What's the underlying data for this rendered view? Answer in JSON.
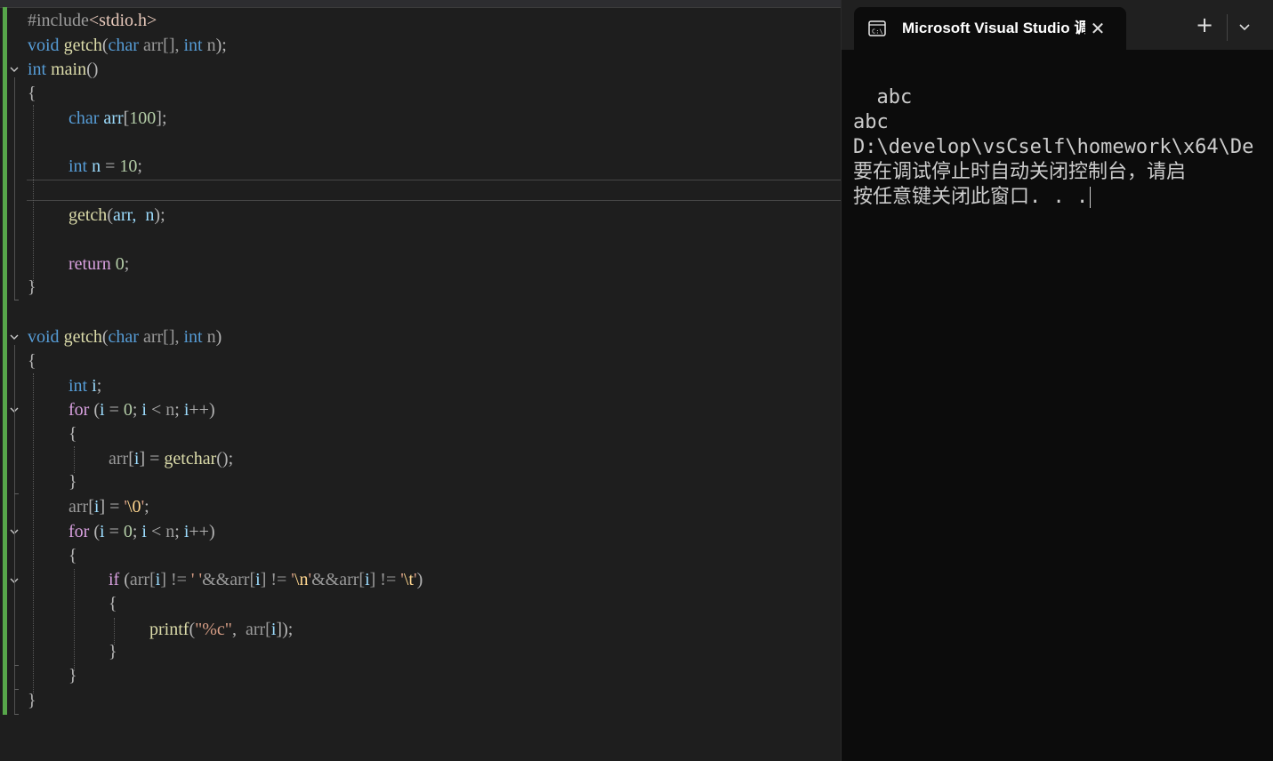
{
  "editor": {
    "lines": {
      "l1": {
        "directive": "#include",
        "header": "<stdio.h>"
      },
      "l2": {
        "kw_void": "void",
        "fn": "getch",
        "p_open": "(",
        "kw_char": "char",
        "param1": " arr[], ",
        "kw_int": "int",
        "param2": " n",
        "p_close": ")",
        "semi": ";"
      },
      "l3": {
        "kw_int": "int",
        "fn": "main",
        "parens": "()"
      },
      "l4": {
        "brace": "{"
      },
      "l5": {
        "kw_char": "char",
        "var": " arr",
        "br_open": "[",
        "num": "100",
        "br_close": "]",
        "semi": ";"
      },
      "l6": {
        "kw_int": "int",
        "var": " n",
        "op": " = ",
        "num": "10",
        "semi": ";"
      },
      "l7": {
        "fn": "getch",
        "p_open": "(",
        "args": "arr,  n",
        "p_close": ")",
        "semi": ";"
      },
      "l8": {
        "kw": "return",
        "num": " 0",
        "semi": ";"
      },
      "l9": {
        "brace": "}"
      },
      "l10": {
        "kw_void": "void",
        "fn": "getch",
        "p_open": "(",
        "kw_char": "char",
        "param1": " arr[], ",
        "kw_int": "int",
        "param2": " n",
        "p_close": ")"
      },
      "l11": {
        "brace": "{"
      },
      "l12": {
        "kw_int": "int",
        "var": " i",
        "semi": ";"
      },
      "l13": {
        "kw": "for",
        "p_open": " (",
        "a": "i",
        "b": " = ",
        "num": "0",
        "c": "; ",
        "d": "i",
        "e": " < ",
        "f": "n",
        "g": "; ",
        "h": "i",
        "i2": "++",
        "p_close": ")"
      },
      "l14": {
        "brace": "{"
      },
      "l15": {
        "arr": "arr",
        "bo": "[",
        "idx": "i",
        "bc": "]",
        "op": " = ",
        "fn": "getchar",
        "call": "()",
        "semi": ";"
      },
      "l16": {
        "brace": "}"
      },
      "l17": {
        "arr": "arr",
        "bo": "[",
        "idx": "i",
        "bc": "]",
        "op": " = ",
        "str_q1": "'",
        "esc": "\\0",
        "str_q2": "'",
        "semi": ";"
      },
      "l18": {
        "kw": "for",
        "p_open": " (",
        "a": "i",
        "b": " = ",
        "num": "0",
        "c": "; ",
        "d": "i",
        "e": " < ",
        "f": "n",
        "g": "; ",
        "h": "i",
        "i2": "++",
        "p_close": ")"
      },
      "l19": {
        "brace": "{"
      },
      "l20": {
        "kw": "if",
        "p_open": " (",
        "a": "arr[",
        "i1": "i",
        "b": "] != ",
        "s1": "' '",
        "c": "&&arr[",
        "i2": "i",
        "d": "] != ",
        "s2q1": "'",
        "s2esc": "\\n",
        "s2q2": "'",
        "e": "&&arr[",
        "i3": "i",
        "f": "] != ",
        "s3q1": "'",
        "s3esc": "\\t",
        "s3q2": "'",
        "p_close": ")"
      },
      "l21": {
        "brace": "{"
      },
      "l22": {
        "fn": "printf",
        "p_open": "(",
        "fmt": "\"%c\"",
        "comma": ",  ",
        "arr": "arr[",
        "idx": "i",
        "tail": "])",
        "semi": ";"
      },
      "l23": {
        "brace": "}"
      },
      "l24": {
        "brace": "}"
      },
      "l25": {
        "brace": "}"
      }
    }
  },
  "terminal": {
    "tab_title": "Microsoft Visual Studio 调试控",
    "tab_icon": "console-icon",
    "close_glyph": "✕",
    "new_tab_glyph": "+",
    "dropdown_icon": "chevron-down-icon",
    "output": [
      "  abc",
      "abc",
      "D:\\develop\\vsCself\\homework\\x64\\De",
      "要在调试停止时自动关闭控制台，请启",
      "按任意键关闭此窗口. . ."
    ]
  },
  "colors": {
    "editor_bg": "#1e1e1e",
    "terminal_bg": "#0c0c0c",
    "keyword": "#569cd6",
    "control_keyword": "#d8a0df",
    "function": "#dcdcaa",
    "number": "#b5cea8",
    "change_bar": "#57a64a"
  }
}
